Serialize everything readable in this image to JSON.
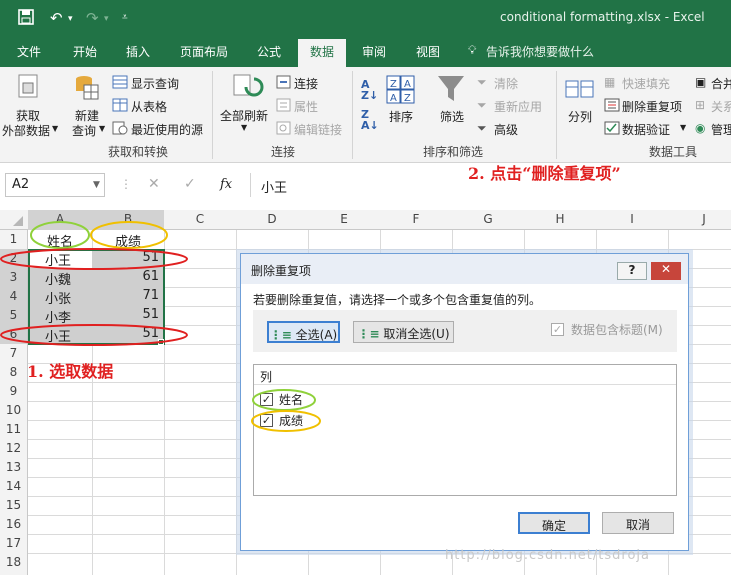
{
  "window": {
    "title": "conditional formatting.xlsx - Excel",
    "quick_access": {
      "save_icon": "save-icon",
      "undo_icon": "undo-icon",
      "redo_icon": "redo-icon",
      "customize_icon": "chevron-down-icon"
    }
  },
  "tabs": [
    "文件",
    "开始",
    "插入",
    "页面布局",
    "公式",
    "数据",
    "审阅",
    "视图"
  ],
  "active_tab": "数据",
  "tell_me": "告诉我你想要做什么",
  "ribbon": {
    "get_transform": {
      "get_external": [
        "获取",
        "外部数据"
      ],
      "new_query": [
        "新建",
        "查询"
      ],
      "show_queries": "显示查询",
      "from_table": "从表格",
      "recent_sources": "最近使用的源",
      "group_label": "获取和转换"
    },
    "connections": {
      "refresh_all": "全部刷新",
      "connections": "连接",
      "properties": "属性",
      "edit_links": "编辑链接",
      "group_label": "连接"
    },
    "sort_filter": {
      "sort": "排序",
      "filter": "筛选",
      "clear": "清除",
      "reapply": "重新应用",
      "advanced": "高级",
      "group_label": "排序和筛选"
    },
    "data_tools": {
      "text_to_columns": "分列",
      "flash_fill": "快速填充",
      "remove_duplicates": "删除重复项",
      "data_validation": "数据验证",
      "consolidate": "合并",
      "relationships": "关系",
      "manage_model": "管理",
      "group_label": "数据工具"
    }
  },
  "formula_bar": {
    "name_box": "A2",
    "fx_label": "fx",
    "value": "小王"
  },
  "columns": [
    "A",
    "B",
    "C",
    "D",
    "E",
    "F",
    "G",
    "H",
    "I",
    "J"
  ],
  "rows": [
    "1",
    "2",
    "3",
    "4",
    "5",
    "6",
    "7",
    "8",
    "9",
    "10",
    "11",
    "12",
    "13",
    "14",
    "15",
    "16",
    "17",
    "18"
  ],
  "cells": {
    "A1": "姓名",
    "B1": "成绩",
    "A2": "小王",
    "B2": "51",
    "A3": "小魏",
    "B3": "61",
    "A4": "小张",
    "B4": "71",
    "A5": "小李",
    "B5": "51",
    "A6": "小王",
    "B6": "51"
  },
  "annotations": {
    "step1": "1. 选取数据",
    "step2": "2. 点击“删除重复项”"
  },
  "dialog": {
    "title": "删除重复项",
    "help": "?",
    "instruction": "若要删除重复值，请选择一个或多个包含重复值的列。",
    "select_all": "全选(A)",
    "unselect_all": "取消全选(U)",
    "has_headers": "数据包含标题(M)",
    "list_header": "列",
    "columns": [
      {
        "label": "姓名",
        "checked": true
      },
      {
        "label": "成绩",
        "checked": true
      }
    ],
    "ok": "确定",
    "cancel": "取消"
  },
  "watermark": "http://blog.csdn.net/tsdroja",
  "colors": {
    "excel_green": "#217346",
    "annotation_red": "#e02020",
    "annotation_green": "#8fd13a",
    "annotation_yellow": "#f0c000"
  }
}
